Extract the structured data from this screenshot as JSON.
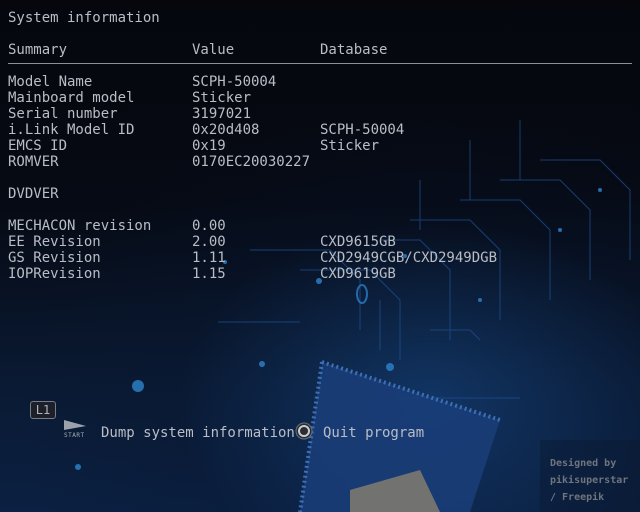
{
  "title": "System information",
  "headers": {
    "summary": "Summary",
    "value": "Value",
    "database": "Database"
  },
  "rows": [
    {
      "label": "Model Name",
      "value": "SCPH-50004",
      "db": ""
    },
    {
      "label": "Mainboard model",
      "value": "Sticker",
      "db": ""
    },
    {
      "label": "Serial number",
      "value": "3197021",
      "db": ""
    },
    {
      "label": "i.Link Model ID",
      "value": "0x20d408",
      "db": "SCPH-50004"
    },
    {
      "label": "EMCS ID",
      "value": "0x19",
      "db": "Sticker"
    },
    {
      "label": "ROMVER",
      "value": "0170EC20030227",
      "db": ""
    },
    {
      "label": "DVDVER",
      "value": "",
      "db": ""
    },
    {
      "label": "MECHACON revision",
      "value": "0.00",
      "db": ""
    },
    {
      "label": "EE Revision",
      "value": "2.00",
      "db": "CXD9615GB"
    },
    {
      "label": "GS Revision",
      "value": "1.11",
      "db": "CXD2949CGB/CXD2949DGB"
    },
    {
      "label": "IOPRevision",
      "value": "1.15",
      "db": "CXD9619GB"
    }
  ],
  "buttons": {
    "l1_label": "L1",
    "start_label": "START",
    "dump_label": "Dump system information",
    "quit_label": "Quit program"
  },
  "credit": {
    "line1": "Designed by",
    "line2": "pikisuperstar",
    "line3": "/ Freepik"
  },
  "icons": {
    "l1": "l1-shoulder-icon",
    "start": "start-button-icon",
    "circle": "circle-button-icon"
  },
  "colors": {
    "text": "#b9bdc5",
    "divider": "#8a8f98",
    "background": "#05080f",
    "accent_blue": "#174a8a"
  }
}
